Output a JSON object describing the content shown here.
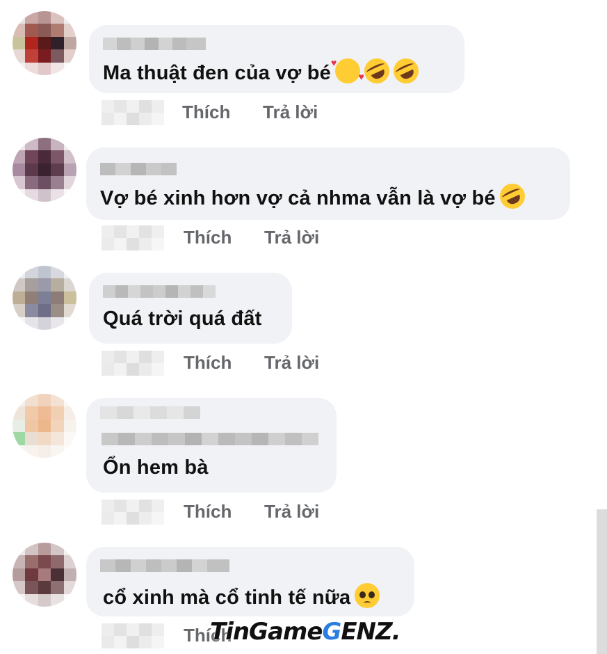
{
  "actions": {
    "like_label": "Thích",
    "reply_label": "Trả lời"
  },
  "comments": [
    {
      "text": "Ma thuật đen của vợ bé",
      "emojis": [
        "smiling-face-with-hearts",
        "rolling-on-floor-laughing",
        "rolling-on-floor-laughing"
      ]
    },
    {
      "text": "Vợ bé xinh hơn vợ cả nhma vẫn là vợ bé",
      "emojis": [
        "rolling-on-floor-laughing"
      ]
    },
    {
      "text": "Quá trời quá đất",
      "emojis": []
    },
    {
      "text": "Ổn hem bà",
      "emojis": []
    },
    {
      "text": "cổ xinh mà cổ tinh tế nữa",
      "emojis": [
        "pleading-face"
      ]
    }
  ],
  "watermark": {
    "part1": "TinGame",
    "part2": "G",
    "part3": "ENZ."
  },
  "colors": {
    "bubble": "#f0f2f5",
    "action_text": "#65676b",
    "text": "#111111"
  }
}
